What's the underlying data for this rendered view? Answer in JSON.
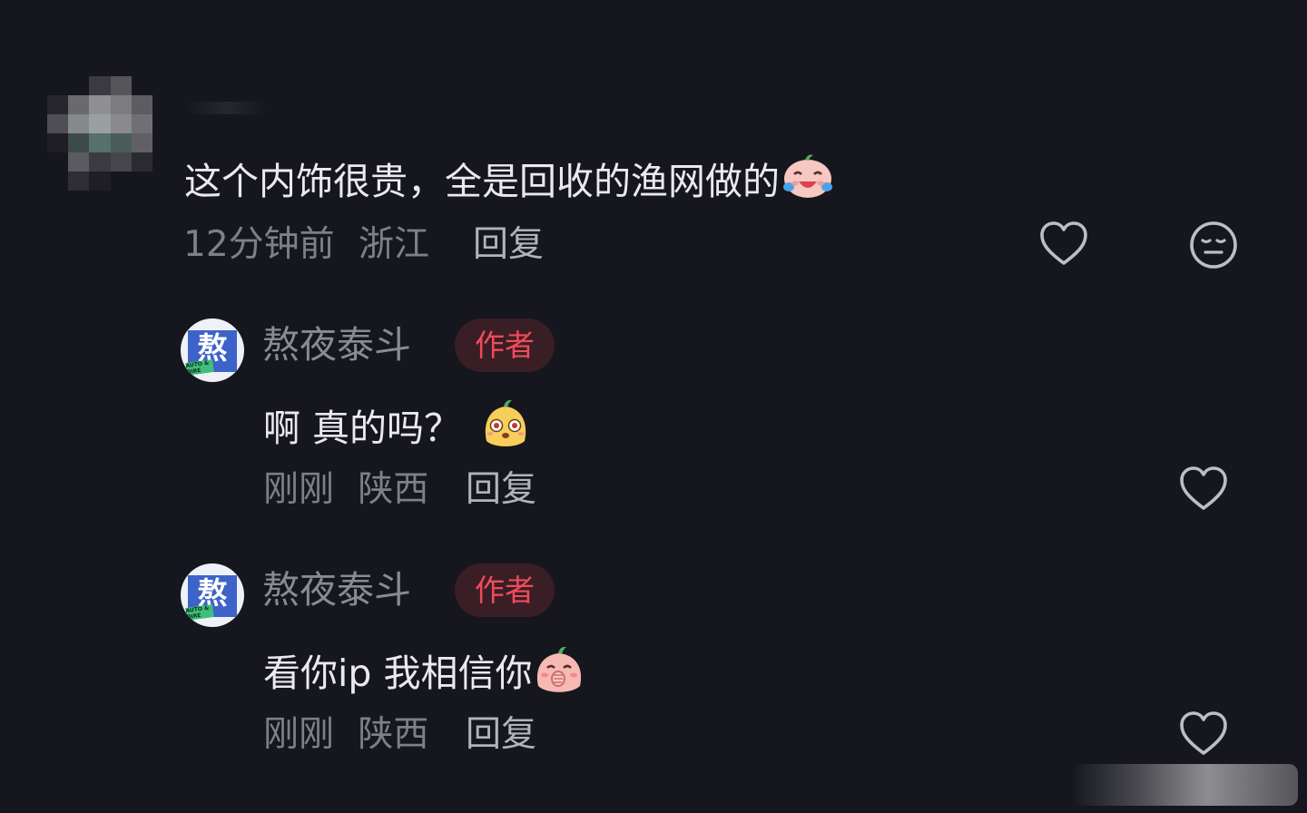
{
  "comments": [
    {
      "text": "这个内饰很贵，全是回收的渔网做的",
      "emoji": "laugh-cry-emoji",
      "time": "12分钟前",
      "location": "浙江",
      "reply_label": "回复"
    }
  ],
  "replies": [
    {
      "username": "熬夜泰斗",
      "avatar_glyph": "熬",
      "avatar_strip": "AUTO & DIRE",
      "badge": "作者",
      "text": "啊 真的吗？",
      "emoji": "surprised-emoji",
      "time": "刚刚",
      "location": "陕西",
      "reply_label": "回复"
    },
    {
      "username": "熬夜泰斗",
      "avatar_glyph": "熬",
      "avatar_strip": "AUTO & DIRE",
      "badge": "作者",
      "text": "看你ip 我相信你",
      "emoji": "shy-emoji",
      "time": "刚刚",
      "location": "陕西",
      "reply_label": "回复"
    }
  ],
  "colors": {
    "background": "#16161e",
    "badge_bg": "#3a1e25",
    "badge_text": "#f04b5a",
    "avatar_tile": "#3d63c9"
  }
}
